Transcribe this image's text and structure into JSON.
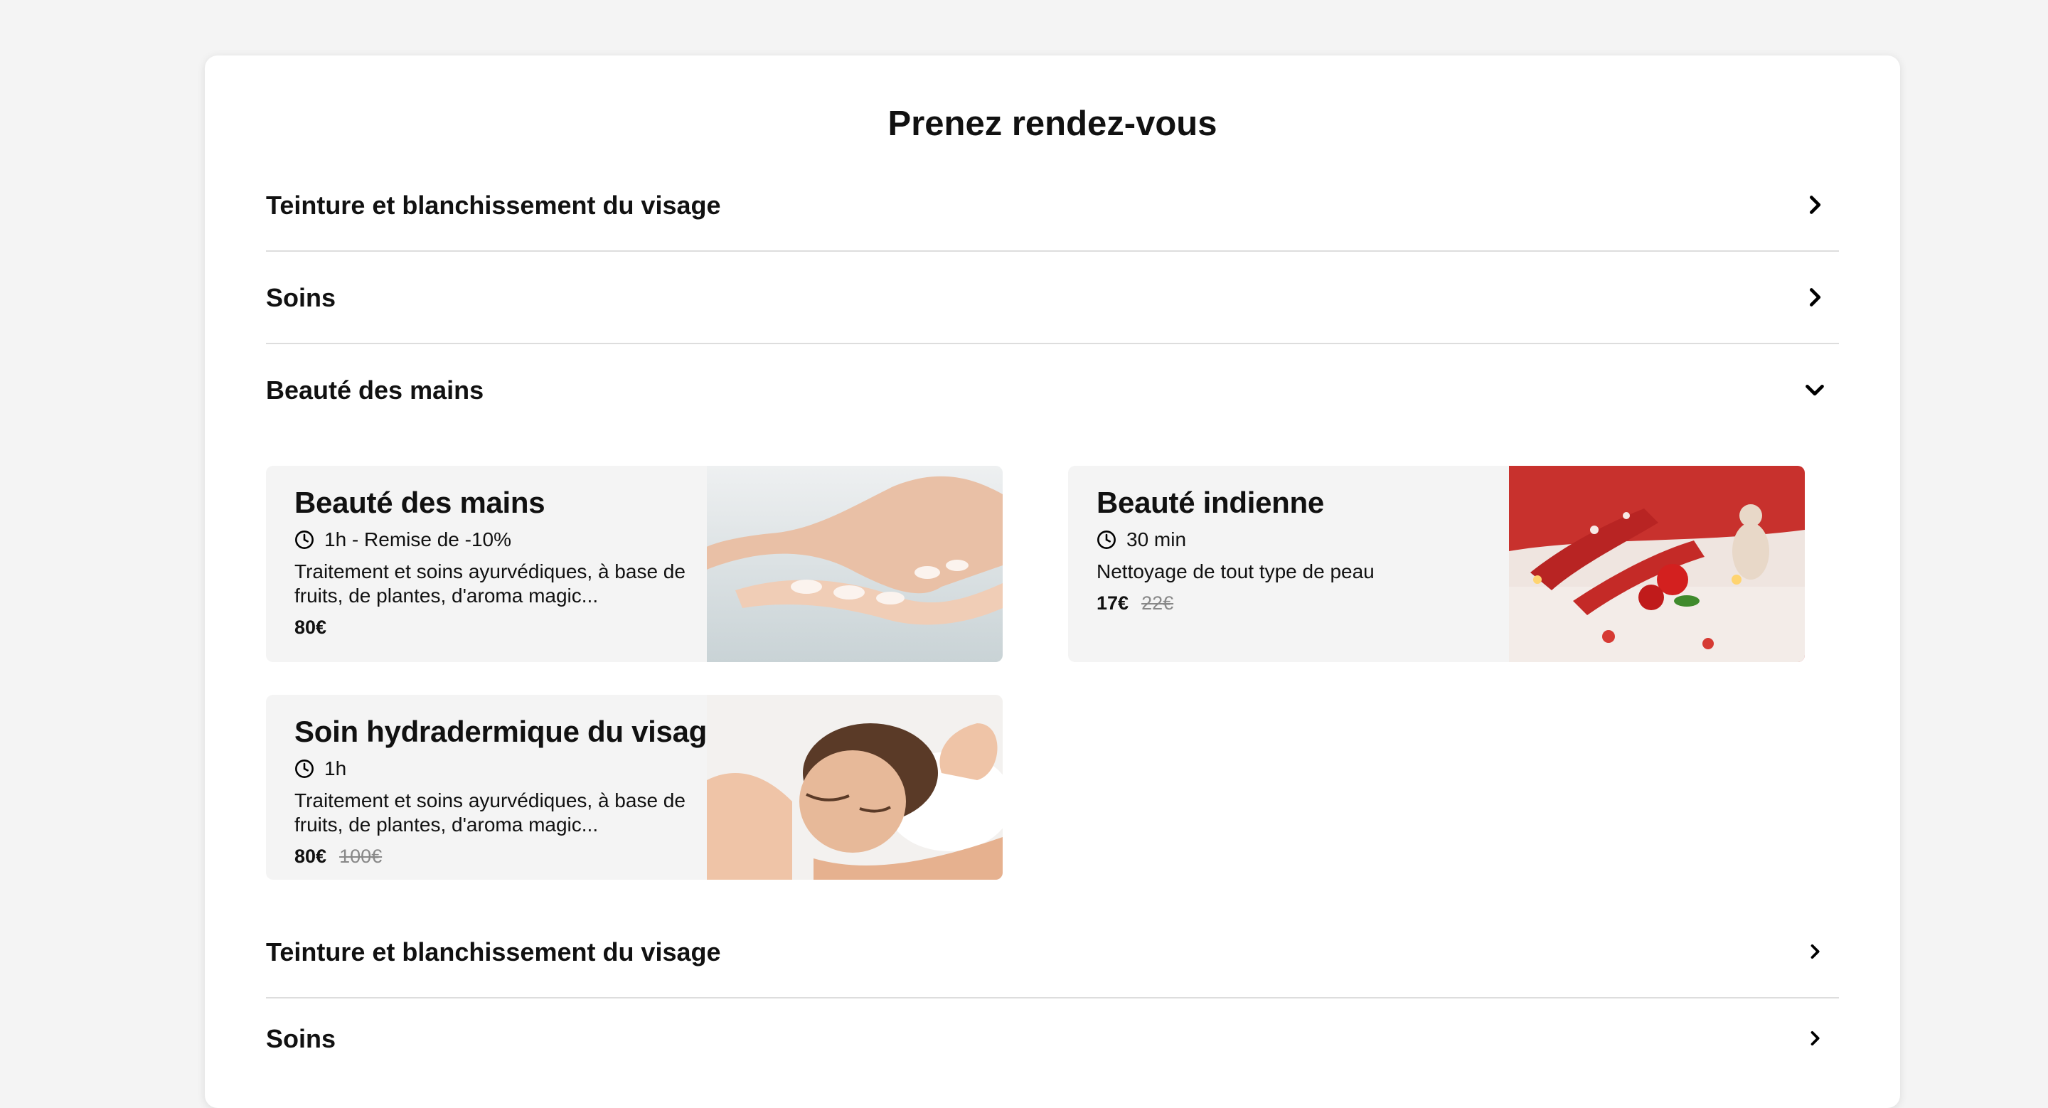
{
  "page": {
    "title": "Prenez rendez-vous"
  },
  "categories": [
    {
      "label": "Teinture et blanchissement du visage",
      "state": "collapsed"
    },
    {
      "label": "Soins",
      "state": "collapsed"
    },
    {
      "label": "Beauté des mains",
      "state": "expanded"
    },
    {
      "label": "Teinture et blanchissement du visage",
      "state": "collapsed"
    },
    {
      "label": "Soins",
      "state": "collapsed"
    }
  ],
  "services": [
    {
      "name": "Beauté des mains",
      "duration": "1h - Remise de -10%",
      "description": "Traitement et soins ayurvédiques, à base de fruits, de plantes, d'aroma magic...",
      "price": "80€",
      "old_price": "",
      "image": "manicured-hands-photo"
    },
    {
      "name": "Beauté indienne",
      "duration": "30 min",
      "description": "Nettoyage de tout type de peau",
      "price": "17€",
      "old_price": "22€",
      "image": "spa-roses-candles-photo"
    },
    {
      "name": "Soin hydradermique du visage",
      "duration": "1h",
      "description": "Traitement et soins ayurvédiques, à base de fruits, de plantes, d'aroma magic...",
      "price": "80€",
      "old_price": "100€",
      "image": "facial-massage-photo"
    }
  ],
  "icons": {
    "collapsed": "chevron-right-icon",
    "expanded": "chevron-down-icon",
    "duration": "clock-icon"
  },
  "colors": {
    "page_bg": "#f4f4f4",
    "card_bg": "#ffffff",
    "service_bg": "#f4f4f4",
    "divider": "#dddddd",
    "old_price": "#888888"
  }
}
